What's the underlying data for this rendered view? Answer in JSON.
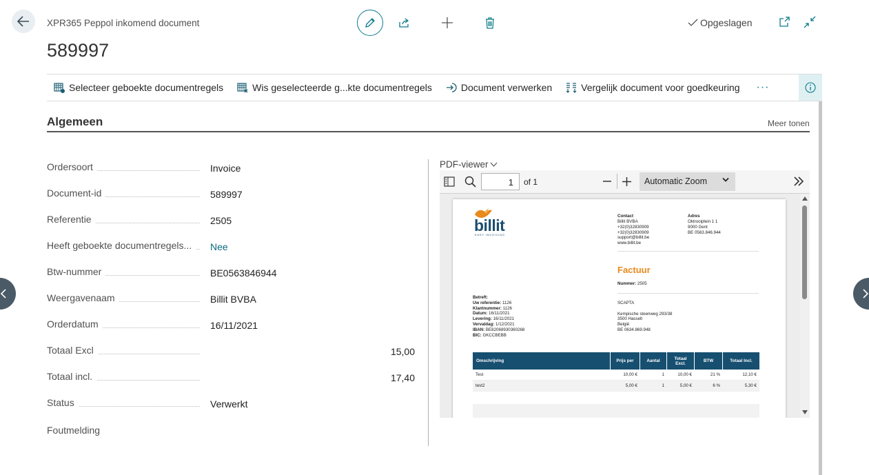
{
  "header": {
    "doc_type": "XPR365 Peppol inkomend document",
    "doc_number": "589997",
    "saved_label": "Opgeslagen"
  },
  "actions": {
    "select_lines": "Selecteer geboekte documentregels",
    "clear_lines": "Wis geselecteerde g...kte documentregels",
    "process": "Document verwerken",
    "compare": "Vergelijk document voor goedkeuring",
    "more": "···"
  },
  "section": {
    "title": "Algemeen",
    "show_more": "Meer tonen"
  },
  "fields": [
    {
      "label": "Ordersoort",
      "value": "Invoice"
    },
    {
      "label": "Document-id",
      "value": "589997"
    },
    {
      "label": "Referentie",
      "value": "2505"
    },
    {
      "label": "Heeft geboekte documentregels...",
      "value": "Nee"
    },
    {
      "label": "Btw-nummer",
      "value": "BE0563846944"
    },
    {
      "label": "Weergavenaam",
      "value": "Billit BVBA"
    },
    {
      "label": "Orderdatum",
      "value": "16/11/2021"
    },
    {
      "label": "Totaal Excl",
      "value": "15,00"
    },
    {
      "label": "Totaal incl.",
      "value": "17,40"
    },
    {
      "label": "Status",
      "value": "Verwerkt"
    },
    {
      "label": "Foutmelding",
      "value": ""
    }
  ],
  "pdf": {
    "title": "PDF-viewer",
    "page": "1",
    "of": "of 1",
    "zoom": "Automatic Zoom",
    "doc": {
      "logo": "billit",
      "tagline": "EASY INVOICING",
      "contact_h": "Contact",
      "contact": [
        "Billit BVBA",
        "+32(0)32830909",
        "+32(0)32830909",
        "support@billit.be",
        "www.billit.be"
      ],
      "adres_h": "Adres",
      "adres": [
        "Oktrooiplein 1 1",
        "9000 Gent",
        "BE 0563.846.944"
      ],
      "factuur": "Factuur",
      "nummer_label": "Nummer:",
      "nummer": "2505",
      "betreft": "Betreft:",
      "meta": [
        {
          "k": "Uw referentie:",
          "v": "1126"
        },
        {
          "k": "Klantnummer:",
          "v": "1126"
        },
        {
          "k": "Datum:",
          "v": "16/11/2021"
        },
        {
          "k": "Levering:",
          "v": "16/11/2021"
        },
        {
          "k": "Vervaldag:",
          "v": "1/12/2021"
        },
        {
          "k": "IBAN:",
          "v": "BE82068930360268"
        },
        {
          "k": "BIC:",
          "v": "GKCCBEBB"
        }
      ],
      "customer": [
        "SCAPTA",
        "",
        "Kempische steenweg 293/38",
        "3500 Hasselt",
        "België",
        "BE 0634.869.948"
      ],
      "table_headers": [
        "Omschrijving",
        "Prijs per",
        "Aantal",
        "Totaal Excl.",
        "BTW",
        "Totaal Incl."
      ],
      "rows": [
        [
          "Test",
          "10,00 €",
          "1",
          "10,00 €",
          "21 %",
          "12,10 €"
        ],
        [
          "test2",
          "5,00 €",
          "1",
          "5,00 €",
          "6 %",
          "5,30 €"
        ]
      ]
    }
  },
  "colors": {
    "accent": "#0c7a8a",
    "table_header": "#174f70",
    "factuur": "#e8891c"
  }
}
